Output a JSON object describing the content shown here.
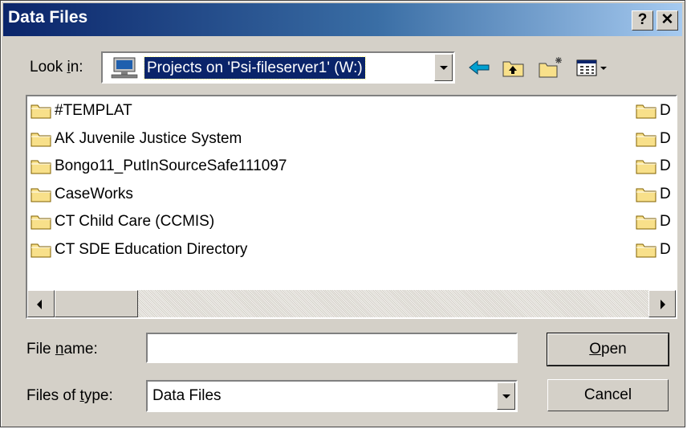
{
  "window": {
    "title": "Data Files",
    "help_label": "?",
    "close_label": "✕"
  },
  "lookin": {
    "label_prefix": "Look ",
    "label_access": "i",
    "label_suffix": "n:",
    "value": "Projects on 'Psi-fileserver1' (W:)",
    "drive_icon": "network-drive-icon"
  },
  "toolbar": {
    "icons": [
      "back-icon",
      "up-one-level-icon",
      "new-folder-icon",
      "view-menu-icon"
    ]
  },
  "files": {
    "left_column": [
      {
        "name": "#TEMPLAT"
      },
      {
        "name": "AK Juvenile Justice System"
      },
      {
        "name": "Bongo11_PutInSourceSafe111097"
      },
      {
        "name": "CaseWorks"
      },
      {
        "name": "CT Child Care  (CCMIS)"
      },
      {
        "name": "CT SDE Education Directory"
      }
    ],
    "right_column": [
      {
        "name": "D"
      },
      {
        "name": "D"
      },
      {
        "name": "D"
      },
      {
        "name": "D"
      },
      {
        "name": "D"
      },
      {
        "name": "D"
      }
    ]
  },
  "filename": {
    "label_prefix": "File ",
    "label_access": "n",
    "label_suffix": "ame:",
    "value": ""
  },
  "filetype": {
    "label_prefix": "Files of ",
    "label_access": "t",
    "label_suffix": "ype:",
    "value": "Data Files"
  },
  "buttons": {
    "open_access": "O",
    "open_rest": "pen",
    "cancel": "Cancel"
  },
  "colors": {
    "titlebar_start": "#0a246a",
    "titlebar_end": "#a6caf0",
    "dialog_face": "#d4d0c8",
    "folder_yellow": "#f8e08a"
  }
}
